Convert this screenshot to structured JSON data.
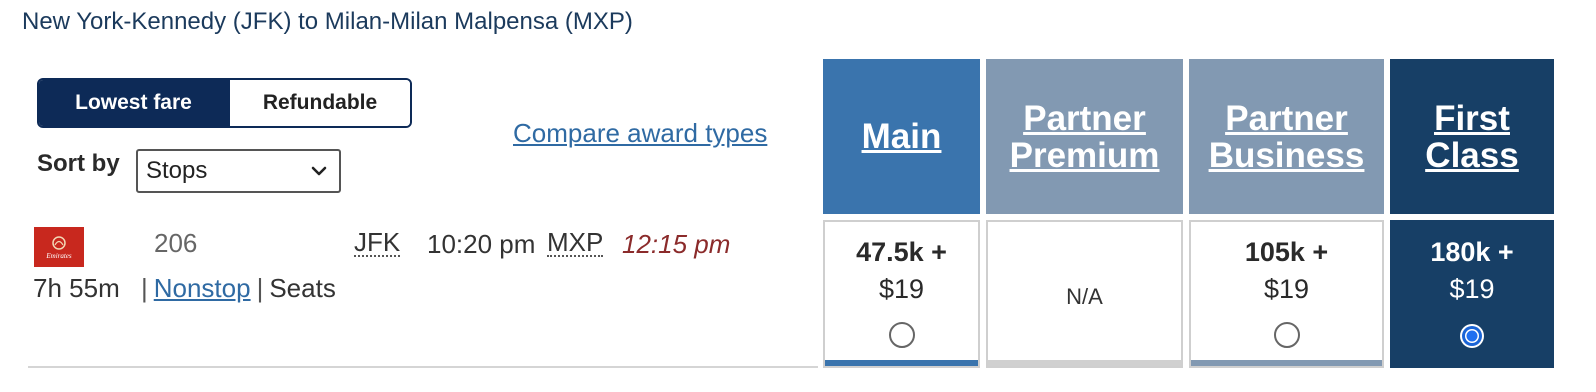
{
  "route": {
    "title": "New York-Kennedy (JFK) to Milan-Milan Malpensa (MXP)"
  },
  "fare_toggle": {
    "active": "Lowest fare",
    "inactive": "Refundable"
  },
  "sort": {
    "label": "Sort by",
    "selected": "Stops"
  },
  "compare_link": "Compare award types",
  "columns": [
    {
      "id": "main",
      "line1": "Main",
      "line2": "",
      "color": "#3a74ad",
      "price_line1": "47.5k +",
      "price_line2": "$19",
      "available": true,
      "selected": false
    },
    {
      "id": "partner-premium",
      "line1": "Partner",
      "line2": "Premium",
      "color": "#8299b2",
      "price_line1": "",
      "price_line2": "",
      "na_text": "N/A",
      "available": false,
      "selected": false
    },
    {
      "id": "partner-business",
      "line1": "Partner",
      "line2": "Business",
      "color": "#8299b2",
      "price_line1": "105k +",
      "price_line2": "$19",
      "available": true,
      "selected": false
    },
    {
      "id": "first-class",
      "line1": "First",
      "line2": "Class",
      "color": "#173f66",
      "price_line1": "180k +",
      "price_line2": "$19",
      "available": true,
      "selected": true
    }
  ],
  "flight": {
    "airline_logo_text": "Emirates",
    "flight_number": "206",
    "origin": "JFK",
    "departure_time": "10:20 pm",
    "destination": "MXP",
    "arrival_time": "12:15 pm",
    "duration": "7h 55m",
    "stops": "Nonstop",
    "seats": "Seats"
  },
  "colors": {
    "toggle_active": "#0d2a57",
    "link": "#2f6aa3",
    "arrival_time": "#8b2b2b",
    "radio_selected": "#1a64d6"
  }
}
